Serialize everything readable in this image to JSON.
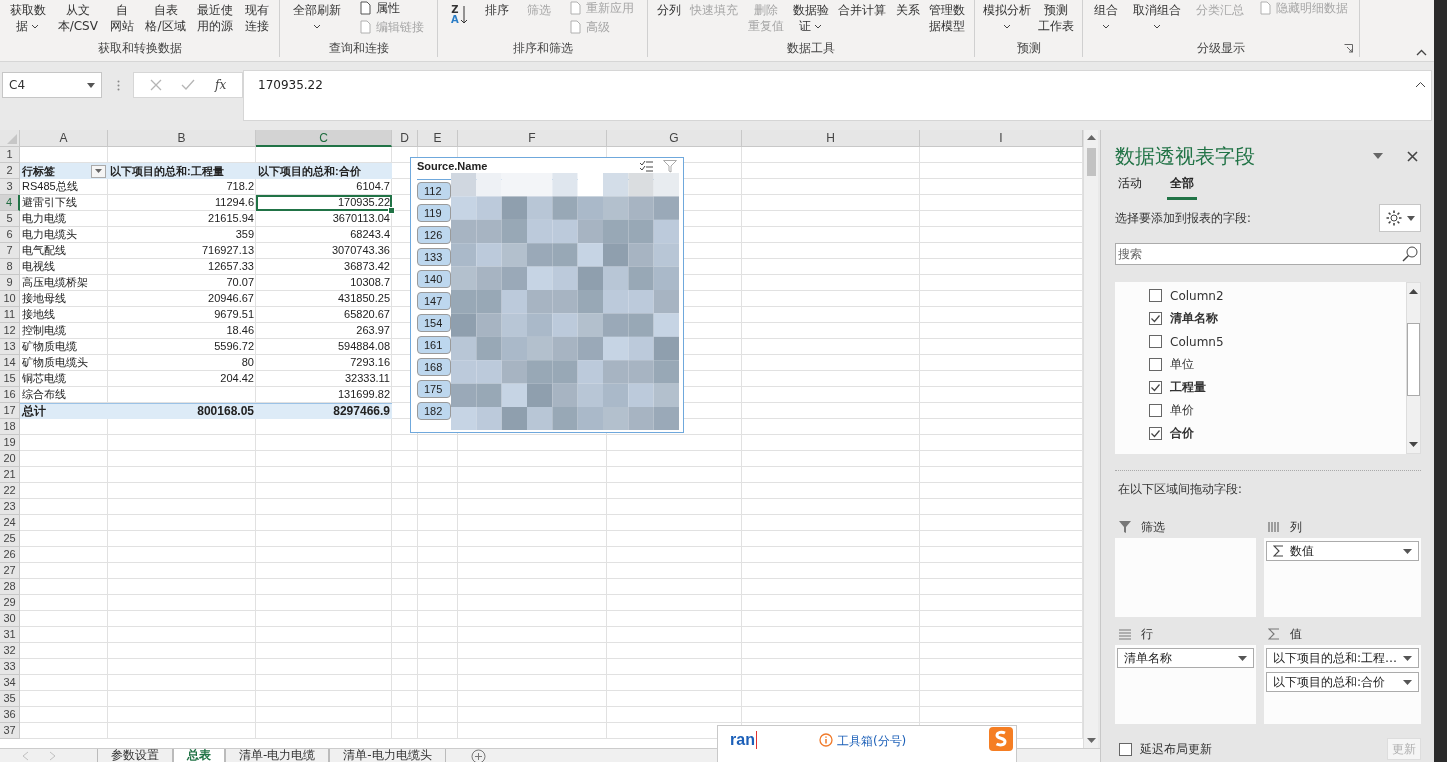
{
  "ribbon": {
    "groups": [
      {
        "label": "获取和转换数据",
        "launcher": false,
        "items": [
          {
            "kind": "large",
            "label": "获取数据",
            "dropdown": true,
            "disabled": false
          },
          {
            "kind": "large",
            "label": "从文本/CSV",
            "dropdown": false,
            "disabled": false
          },
          {
            "kind": "large",
            "label": "自网站",
            "dropdown": false,
            "disabled": false
          },
          {
            "kind": "large",
            "label": "自表格/区域",
            "dropdown": false,
            "disabled": false
          },
          {
            "kind": "large",
            "label": "最近使用的源",
            "dropdown": false,
            "disabled": false
          },
          {
            "kind": "large",
            "label": "现有连接",
            "dropdown": false,
            "disabled": false
          }
        ]
      },
      {
        "label": "查询和连接",
        "launcher": false,
        "items": [
          {
            "kind": "large",
            "label": "全部刷新",
            "dropdown": true,
            "disabled": false
          },
          {
            "kind": "stack",
            "items": [
              {
                "label": "属性",
                "disabled": false
              },
              {
                "label": "编辑链接",
                "disabled": true
              }
            ]
          }
        ]
      },
      {
        "label": "排序和筛选",
        "launcher": false,
        "items": [
          {
            "kind": "sort",
            "top": "Z",
            "bottom": "A"
          },
          {
            "kind": "large",
            "label": "排序",
            "dropdown": false,
            "disabled": false
          },
          {
            "kind": "large",
            "label": "筛选",
            "dropdown": false,
            "disabled": true
          },
          {
            "kind": "stack",
            "items": [
              {
                "label": "重新应用",
                "disabled": true
              },
              {
                "label": "高级",
                "disabled": true
              }
            ]
          }
        ]
      },
      {
        "label": "数据工具",
        "launcher": false,
        "items": [
          {
            "kind": "large",
            "label": "分列",
            "dropdown": false,
            "disabled": false
          },
          {
            "kind": "large",
            "label": "快速填充",
            "dropdown": false,
            "disabled": true
          },
          {
            "kind": "large",
            "label": "删除重复值",
            "dropdown": false,
            "disabled": true
          },
          {
            "kind": "large",
            "label": "数据验证",
            "dropdown": true,
            "disabled": false
          },
          {
            "kind": "large",
            "label": "合并计算",
            "dropdown": false,
            "disabled": false
          },
          {
            "kind": "large",
            "label": "关系",
            "dropdown": false,
            "disabled": false
          },
          {
            "kind": "large",
            "label": "管理数据模型",
            "dropdown": false,
            "disabled": false
          }
        ]
      },
      {
        "label": "预测",
        "launcher": false,
        "items": [
          {
            "kind": "large",
            "label": "模拟分析",
            "dropdown": true,
            "disabled": false
          },
          {
            "kind": "large",
            "label": "预测工作表",
            "dropdown": false,
            "disabled": false
          }
        ]
      },
      {
        "label": "分级显示",
        "launcher": true,
        "items": [
          {
            "kind": "large",
            "label": "组合",
            "dropdown": true,
            "disabled": false
          },
          {
            "kind": "large",
            "label": "取消组合",
            "dropdown": true,
            "disabled": false
          },
          {
            "kind": "large",
            "label": "分类汇总",
            "dropdown": false,
            "disabled": true
          },
          {
            "kind": "stack",
            "items": [
              {
                "label": "隐藏明细数据",
                "disabled": true
              }
            ]
          }
        ]
      }
    ]
  },
  "formula_bar": {
    "name_box": "C4",
    "fx": "fx",
    "formula": "170935.22"
  },
  "sheet": {
    "columns": [
      {
        "label": "A",
        "selected": false
      },
      {
        "label": "B",
        "selected": false
      },
      {
        "label": "C",
        "selected": true
      },
      {
        "label": "D",
        "selected": false
      },
      {
        "label": "E",
        "selected": false
      },
      {
        "label": "F",
        "selected": false
      },
      {
        "label": "G",
        "selected": false
      },
      {
        "label": "H",
        "selected": false
      },
      {
        "label": "I",
        "selected": false
      }
    ],
    "row_headers": [
      {
        "label": "1",
        "selected": false
      },
      {
        "label": "2",
        "selected": false
      },
      {
        "label": "3",
        "selected": false
      },
      {
        "label": "4",
        "selected": true
      },
      {
        "label": "5",
        "selected": false
      },
      {
        "label": "6",
        "selected": false
      },
      {
        "label": "7",
        "selected": false
      },
      {
        "label": "8",
        "selected": false
      },
      {
        "label": "9",
        "selected": false
      },
      {
        "label": "10",
        "selected": false
      },
      {
        "label": "11",
        "selected": false
      },
      {
        "label": "12",
        "selected": false
      },
      {
        "label": "13",
        "selected": false
      },
      {
        "label": "14",
        "selected": false
      },
      {
        "label": "15",
        "selected": false
      },
      {
        "label": "16",
        "selected": false
      },
      {
        "label": "17",
        "selected": false
      },
      {
        "label": "18",
        "selected": false
      },
      {
        "label": "19",
        "selected": false
      },
      {
        "label": "20",
        "selected": false
      },
      {
        "label": "21",
        "selected": false
      },
      {
        "label": "22",
        "selected": false
      },
      {
        "label": "23",
        "selected": false
      },
      {
        "label": "24",
        "selected": false
      },
      {
        "label": "25",
        "selected": false
      },
      {
        "label": "26",
        "selected": false
      },
      {
        "label": "27",
        "selected": false
      },
      {
        "label": "28",
        "selected": false
      },
      {
        "label": "29",
        "selected": false
      },
      {
        "label": "30",
        "selected": false
      },
      {
        "label": "31",
        "selected": false
      },
      {
        "label": "32",
        "selected": false
      },
      {
        "label": "33",
        "selected": false
      },
      {
        "label": "34",
        "selected": false
      },
      {
        "label": "35",
        "selected": false
      },
      {
        "label": "36",
        "selected": false
      },
      {
        "label": "37",
        "selected": false
      }
    ],
    "pivot": {
      "row_label": "行标签",
      "headers": [
        "以下项目的总和:工程量",
        "以下项目的总和:合价"
      ],
      "rows": [
        {
          "label": "RS485总线",
          "qty": "718.2",
          "total": "6104.7",
          "selected": false
        },
        {
          "label": "避雷引下线",
          "qty": "11294.6",
          "total": "170935.22",
          "selected": true
        },
        {
          "label": "电力电缆",
          "qty": "21615.94",
          "total": "3670113.04",
          "selected": false
        },
        {
          "label": "电力电缆头",
          "qty": "359",
          "total": "68243.4",
          "selected": false
        },
        {
          "label": "电气配线",
          "qty": "716927.13",
          "total": "3070743.36",
          "selected": false
        },
        {
          "label": "电视线",
          "qty": "12657.33",
          "total": "36873.42",
          "selected": false
        },
        {
          "label": "高压电缆桥架",
          "qty": "70.07",
          "total": "10308.7",
          "selected": false
        },
        {
          "label": "接地母线",
          "qty": "20946.67",
          "total": "431850.25",
          "selected": false
        },
        {
          "label": "接地线",
          "qty": "9679.51",
          "total": "65820.67",
          "selected": false
        },
        {
          "label": "控制电缆",
          "qty": "18.46",
          "total": "263.97",
          "selected": false
        },
        {
          "label": "矿物质电缆",
          "qty": "5596.72",
          "total": "594884.08",
          "selected": false
        },
        {
          "label": "矿物质电缆头",
          "qty": "80",
          "total": "7293.16",
          "selected": false
        },
        {
          "label": "铜芯电缆",
          "qty": "204.42",
          "total": "32333.11",
          "selected": false
        },
        {
          "label": "综合布线",
          "total": "131699.82",
          "selected": false
        }
      ],
      "grand_total": {
        "label": "总计",
        "qty": "800168.05",
        "total": "8297466.9"
      }
    },
    "slicer": {
      "title": "Source.Name",
      "items": [
        {
          "label": "112",
          "selected": true
        },
        {
          "label": "119",
          "selected": true
        },
        {
          "label": "126",
          "selected": true
        },
        {
          "label": "133",
          "selected": true
        },
        {
          "label": "140",
          "selected": true
        },
        {
          "label": "147",
          "selected": true
        },
        {
          "label": "154",
          "selected": true
        },
        {
          "label": "161",
          "selected": true
        },
        {
          "label": "168",
          "selected": true
        },
        {
          "label": "175",
          "selected": true
        },
        {
          "label": "182",
          "selected": true
        }
      ]
    }
  },
  "sheet_tabs": [
    {
      "label": "参数设置",
      "selected": false
    },
    {
      "label": "总表",
      "selected": true
    },
    {
      "label": "清单-电力电缆",
      "selected": false
    },
    {
      "label": "清单-电力电缆头",
      "selected": false
    }
  ],
  "ime": {
    "input": "ran",
    "suggestion": "工具箱(分号)"
  },
  "pane": {
    "title": "数据透视表字段",
    "tabs": [
      {
        "label": "活动",
        "selected": false
      },
      {
        "label": "全部",
        "selected": true
      }
    ],
    "choose_label": "选择要添加到报表的字段:",
    "search_placeholder": "搜索",
    "fields": [
      {
        "label": "Column2",
        "checked": false
      },
      {
        "label": "清单名称",
        "checked": true
      },
      {
        "label": "Column5",
        "checked": false
      },
      {
        "label": "单位",
        "checked": false
      },
      {
        "label": "工程量",
        "checked": true
      },
      {
        "label": "单价",
        "checked": false
      },
      {
        "label": "合价",
        "checked": true
      }
    ],
    "drag_label": "在以下区域间拖动字段:",
    "areas": [
      {
        "kind": "filter",
        "label": "筛选"
      },
      {
        "kind": "columns",
        "label": "列",
        "items": [
          {
            "label": "数值",
            "kind": "sigma"
          }
        ]
      },
      {
        "kind": "rows",
        "label": "行",
        "items": [
          {
            "label": "清单名称",
            "kind": "plain"
          }
        ]
      },
      {
        "kind": "values",
        "label": "值",
        "items": [
          {
            "label": "以下项目的总和:工程…",
            "kind": "plain"
          },
          {
            "label": "以下项目的总和:合价",
            "kind": "plain"
          }
        ]
      }
    ],
    "defer_update": {
      "label": "延迟布局更新",
      "checked": false
    },
    "update_button": {
      "label": "更新",
      "disabled": true
    }
  }
}
